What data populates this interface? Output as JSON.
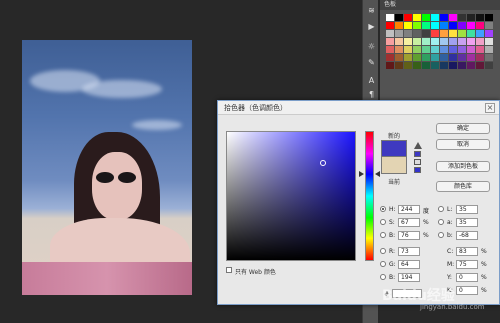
{
  "swatches_panel": {
    "title": "色板"
  },
  "swatch_colors": [
    "#ffffff",
    "#000000",
    "#ff0000",
    "#ffff00",
    "#00ff00",
    "#00ffff",
    "#0000ff",
    "#ff00ff",
    "#333333",
    "#222222",
    "#111111",
    "#000000",
    "#ff0000",
    "#ff8000",
    "#ffff00",
    "#80ff00",
    "#00ff80",
    "#00ffff",
    "#0080ff",
    "#0000ff",
    "#8000ff",
    "#ff00ff",
    "#ff0080",
    "#808080",
    "#c0c0c0",
    "#a0a0a0",
    "#808080",
    "#606060",
    "#404040",
    "#ff4040",
    "#ffa040",
    "#ffe040",
    "#a0e040",
    "#40e0a0",
    "#40a0ff",
    "#a040ff",
    "#f7a0a0",
    "#f7c8a0",
    "#f7f0a0",
    "#c8f0a0",
    "#a0f0c8",
    "#a0f0f0",
    "#a0c8f0",
    "#a0a0f0",
    "#c8a0f0",
    "#f0a0f0",
    "#f0a0c8",
    "#e0e0e0",
    "#e06060",
    "#e09060",
    "#e0d060",
    "#90d060",
    "#60d090",
    "#60d0d0",
    "#6090e0",
    "#6060e0",
    "#9060e0",
    "#d060d0",
    "#e06090",
    "#b0b0b0",
    "#a03030",
    "#a06030",
    "#a0a030",
    "#60a030",
    "#30a060",
    "#30a0a0",
    "#3060a0",
    "#3030a0",
    "#6030a0",
    "#a030a0",
    "#a03060",
    "#707070",
    "#601818",
    "#603818",
    "#606018",
    "#386018",
    "#186038",
    "#186060",
    "#183860",
    "#181860",
    "#381860",
    "#601860",
    "#601838",
    "#404040"
  ],
  "dialog": {
    "title": "拾色器（色调颜色）",
    "close": "×",
    "new_label": "新的",
    "current_label": "当前",
    "buttons": {
      "ok": "确定",
      "cancel": "取消",
      "add_to_swatches": "添加到色板",
      "color_libraries": "颜色库"
    },
    "web_only_label": "只有 Web 颜色",
    "fields": {
      "H": {
        "label": "H:",
        "value": "244",
        "unit": "度"
      },
      "S": {
        "label": "S:",
        "value": "67",
        "unit": "%"
      },
      "B": {
        "label": "B:",
        "value": "76",
        "unit": "%"
      },
      "R": {
        "label": "R:",
        "value": "73",
        "unit": ""
      },
      "G": {
        "label": "G:",
        "value": "64",
        "unit": ""
      },
      "Bv": {
        "label": "B:",
        "value": "194",
        "unit": ""
      },
      "L": {
        "label": "L:",
        "value": "35",
        "unit": ""
      },
      "a": {
        "label": "a:",
        "value": "35",
        "unit": ""
      },
      "b": {
        "label": "b:",
        "value": "-68",
        "unit": ""
      },
      "C": {
        "label": "C:",
        "value": "83",
        "unit": "%"
      },
      "M": {
        "label": "M:",
        "value": "75",
        "unit": "%"
      },
      "Y": {
        "label": "Y:",
        "value": "0",
        "unit": "%"
      },
      "K": {
        "label": "K:",
        "value": "0",
        "unit": "%"
      }
    },
    "hex_label": "#"
  },
  "watermark": {
    "brand": "Baidu经验",
    "sub": "jingyan.baidu.com"
  },
  "colors": {
    "new_color": "#3f39c0",
    "current_color": "#e3d4b3",
    "dialog_border": "#7c9ec9"
  }
}
